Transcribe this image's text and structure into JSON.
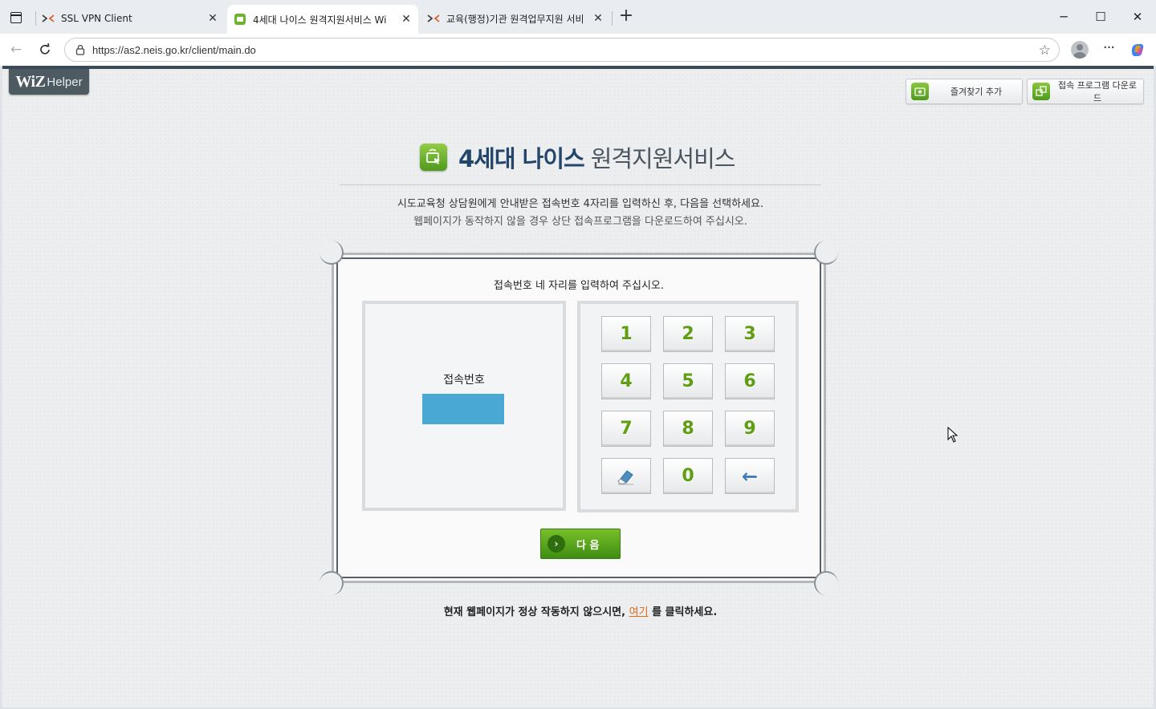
{
  "browser": {
    "tabs": [
      {
        "title": "SSL VPN Client",
        "active": false
      },
      {
        "title": "4세대 나이스 원격지원서비스 Wi",
        "active": true
      },
      {
        "title": "교육(행정)기관 원격업무지원 서비",
        "active": false
      }
    ],
    "url": "https://as2.neis.go.kr/client/main.do",
    "new_tab_symbol": "+",
    "window_controls": {
      "minimize": "─",
      "maximize": "☐",
      "close": "✕"
    }
  },
  "page": {
    "logo": {
      "wiz": "WiZ",
      "helper": "Helper"
    },
    "top_buttons": {
      "bookmark": "즐겨찾기 추가",
      "download": "접속 프로그램 다운로드"
    },
    "title": {
      "strong": "4세대 나이스",
      "light": "원격지원서비스"
    },
    "guide_line1": "시도교육청 상담원에게 안내받은 접속번호 4자리를 입력하신 후, 다음을 선택하세요.",
    "guide_line2": "웹페이지가 동작하지 않을 경우 상단 접속프로그램을 다운로드하여 주십시오.",
    "instruction": "접속번호 네 자리를 입력하여 주십시오.",
    "code_label": "접속번호",
    "code_value": "",
    "keypad": {
      "keys": [
        "1",
        "2",
        "3",
        "4",
        "5",
        "6",
        "7",
        "8",
        "9",
        "clear",
        "0",
        "back"
      ],
      "zero": "0",
      "back_symbol": "←"
    },
    "next_button": "다 음",
    "next_arrow": "›",
    "footer": {
      "before": "현재 웹페이지가 정상 작동하지 않으시면,",
      "link": "여기",
      "after": "를 클릭하세요."
    }
  },
  "colors": {
    "accent_green": "#5f9e12",
    "title_navy": "#24466b",
    "code_field": "#4aa8d4",
    "link_orange": "#e06a1a"
  }
}
